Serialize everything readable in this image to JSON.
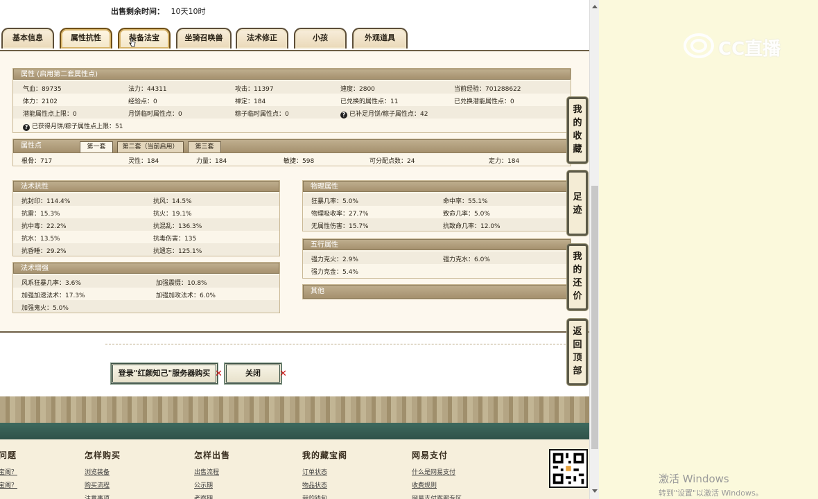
{
  "sale_time": {
    "label": "出售剩余时间：",
    "value": "10天10时"
  },
  "tabs": [
    {
      "label": "基本信息"
    },
    {
      "label": "属性抗性"
    },
    {
      "label": "装备法宝"
    },
    {
      "label": "坐骑召唤兽"
    },
    {
      "label": "法术修正"
    },
    {
      "label": "小孩"
    },
    {
      "label": "外观道具"
    }
  ],
  "attributes": {
    "title": "属性 (启用第二套属性点)",
    "rows": [
      [
        "气血：89735",
        "法力：44311",
        "攻击：11397",
        "速度：2800",
        "当前经验：701288622"
      ],
      [
        "体力：2102",
        "经验点：0",
        "禅定：184",
        "已兑换的属性点：11",
        "已兑换潜能属性点：0"
      ],
      [
        "潜能属性点上限：0",
        "月饼临时属性点：0",
        "粽子临时属性点：0",
        "已补足月饼/粽子属性点：42",
        ""
      ]
    ],
    "note": "已获得月饼/粽子属性点上限：51"
  },
  "points": {
    "title": "属性点",
    "subtabs": [
      "第一套",
      "第二套（当前启用）",
      "第三套"
    ],
    "values": [
      "根骨：717",
      "灵性：184",
      "力量：184",
      "敏捷：598",
      "可分配点数：24",
      "定力：184"
    ]
  },
  "magic_resist": {
    "title": "法术抗性",
    "rows": [
      [
        "抗封印：114.4%",
        "抗风：14.5%"
      ],
      [
        "抗雷：15.3%",
        "抗火：19.1%"
      ],
      [
        "抗中毒：22.2%",
        "抗混乱：136.3%"
      ],
      [
        "抗水：13.5%",
        "抗毒伤害：135"
      ],
      [
        "抗昏睡：29.2%",
        "抗遗忘：125.1%"
      ]
    ]
  },
  "magic_boost": {
    "title": "法术增强",
    "rows": [
      [
        "风系狂暴几率：3.6%",
        "加强震慑：10.8%"
      ],
      [
        "加强加速法术：17.3%",
        "加强加攻法术：6.0%"
      ],
      [
        "加强鬼火：5.0%",
        ""
      ]
    ]
  },
  "physical": {
    "title": "物理属性",
    "rows": [
      [
        "狂暴几率：5.0%",
        "命中率：55.1%"
      ],
      [
        "物理吸收率：27.7%",
        "致命几率：5.0%"
      ],
      [
        "无属性伤害：15.7%",
        "抗致命几率：12.0%"
      ]
    ]
  },
  "elements": {
    "title": "五行属性",
    "rows": [
      [
        "强力克火：2.9%",
        "强力克水：6.0%"
      ],
      [
        "强力克金：5.4%",
        ""
      ]
    ]
  },
  "other": {
    "title": "其他"
  },
  "sidebar": [
    {
      "label": "我的收藏"
    },
    {
      "label": "足迹"
    },
    {
      "label": "我的还价"
    },
    {
      "label": "返回顶部"
    }
  ],
  "buttons": {
    "buy": "登录\"红颜知己\"服务器购买",
    "close": "关闭"
  },
  "footer": {
    "columns": [
      {
        "title": "问题",
        "links": [
          "宝阁？",
          "宝阁？",
          ""
        ]
      },
      {
        "title": "怎样购买",
        "links": [
          "浏览装备",
          "购买流程",
          "注意事项"
        ]
      },
      {
        "title": "怎样出售",
        "links": [
          "出售流程",
          "公示期",
          "考察期"
        ]
      },
      {
        "title": "我的藏宝阁",
        "links": [
          "订单状态",
          "物品状态",
          "我的钱包"
        ]
      },
      {
        "title": "网易支付",
        "links": [
          "什么是网易支付",
          "收费规则",
          "网易支付客服专区"
        ]
      }
    ]
  },
  "watermark": "CC直播",
  "windows_activation": {
    "line1": "激活 Windows",
    "line2": "转到\"设置\"以激活 Windows。"
  }
}
